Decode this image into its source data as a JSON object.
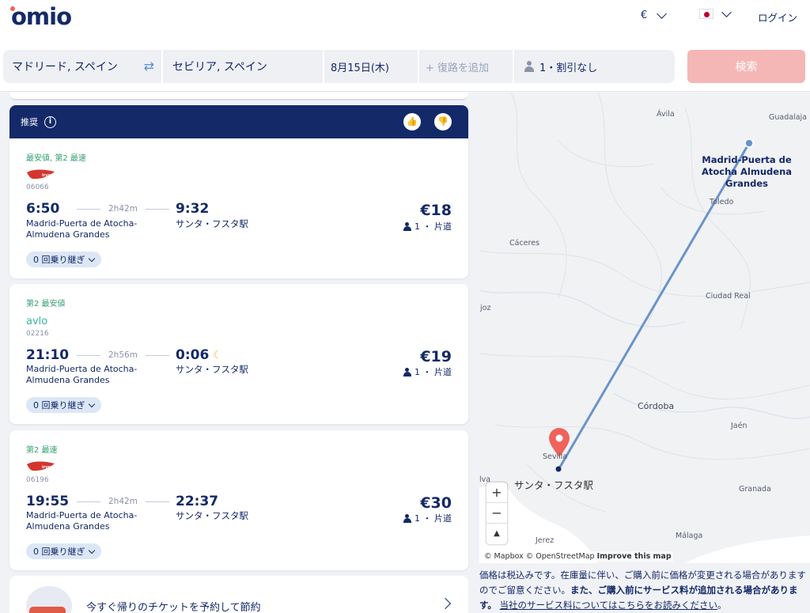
{
  "header": {
    "logo": "omio",
    "currency": "€",
    "login": "ログイン"
  },
  "search": {
    "from": "マドリード, スペイン",
    "to": "セビリア, スペイン",
    "date": "8月15日(木)",
    "return_placeholder": "+ 復路を追加",
    "passengers": "1・割引なし",
    "search_button": "検索"
  },
  "recommended": {
    "label": "推奨",
    "like_icon": "thumbs-up-icon",
    "dislike_icon": "thumbs-down-icon"
  },
  "results": [
    {
      "tag": "最安値, 第2 最速",
      "operator": "iryo",
      "train_no": "06066",
      "dep_time": "6:50",
      "duration": "2h42m",
      "arr_time": "9:32",
      "dep_station": "Madrid-Puerta de Atocha-Almudena Grandes",
      "arr_station": "サンタ・フスタ駅",
      "price": "€18",
      "pax": "1 ・ 片道",
      "changes": "0 回乗り継ぎ"
    },
    {
      "tag": "第2 最安値",
      "operator": "avlo",
      "train_no": "02216",
      "dep_time": "21:10",
      "duration": "2h56m",
      "arr_time": "0:06",
      "dep_station": "Madrid-Puerta de Atocha-Almudena Grandes",
      "arr_station": "サンタ・フスタ駅",
      "price": "€19",
      "pax": "1 ・ 片道",
      "changes": "0 回乗り継ぎ"
    },
    {
      "tag": "第2 最速",
      "operator": "iryo",
      "train_no": "06196",
      "dep_time": "19:55",
      "duration": "2h42m",
      "arr_time": "22:37",
      "dep_station": "Madrid-Puerta de Atocha-Almudena Grandes",
      "arr_station": "サンタ・フスタ駅",
      "price": "€30",
      "pax": "1 ・ 片道",
      "changes": "0 回乗り継ぎ"
    }
  ],
  "promo": {
    "text": "今すぐ帰りのチケットを予約して節約"
  },
  "map": {
    "cities": [
      "Ávila",
      "Guadalaja",
      "Toledo",
      "Cáceres",
      "Ciudad Real",
      "joz",
      "Córdoba",
      "Jaén",
      "Sevilla",
      "lva",
      "Granada",
      "Málaga",
      "Jerez"
    ],
    "origin_label": "Madrid-Puerta de Atocha Almudena Grandes",
    "destination_label": "サンタ・フスタ駅",
    "zoom_in": "+",
    "zoom_out": "−",
    "compass": "▲",
    "attribution_mapbox": "© Mapbox",
    "attribution_osm": "© OpenStreetMap",
    "improve": "Improve this map"
  },
  "disclaimer": {
    "part1": "価格は税込みです。在庫量に伴い、ご購入前に価格が変更される場合がありますのでご留意ください。",
    "part2": "また、ご購入前にサービス料が追加される場合があります。",
    "link": "当社のサービス料についてはこちらをお読みください",
    "part3": "。"
  },
  "colors": {
    "brand_navy": "#132968",
    "accent_red": "#f0625c",
    "search_button": "#f4b7b6",
    "tag_green": "#35a070",
    "route_blue": "#6a94cc"
  }
}
